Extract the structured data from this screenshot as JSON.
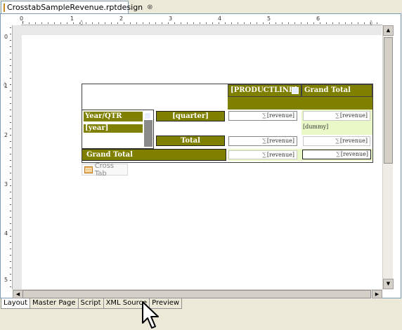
{
  "editor_tab": {
    "label": "CrosstabSampleRevenue.rptdesign",
    "close": "⊗"
  },
  "ruler": {
    "h_numbers": [
      "0",
      "1",
      "2",
      "3",
      "4",
      "5",
      "6"
    ],
    "v_numbers": [
      "0",
      "1",
      "2",
      "3",
      "4",
      "5"
    ]
  },
  "crosstab": {
    "column_dimension": "[PRODUCTLINE]",
    "grand_total_col": "Grand Total",
    "row_dimension_title": "Year/QTR",
    "row_year": "[year]",
    "row_quarter": "[quarter]",
    "subtotal_label": "Total",
    "grand_total_row": "Grand Total",
    "measure": "[revenue]",
    "sigma": "∑",
    "dummy": "[dummy]"
  },
  "chip": {
    "label": "Cross Tab"
  },
  "bottom_tabs": [
    "Layout",
    "Master Page",
    "Script",
    "XML Source",
    "Preview"
  ],
  "active_tab": "Layout",
  "colors": {
    "olive": "#7f7f00",
    "light_green": "#eaf8c8",
    "frame_border": "#7f9db9"
  }
}
